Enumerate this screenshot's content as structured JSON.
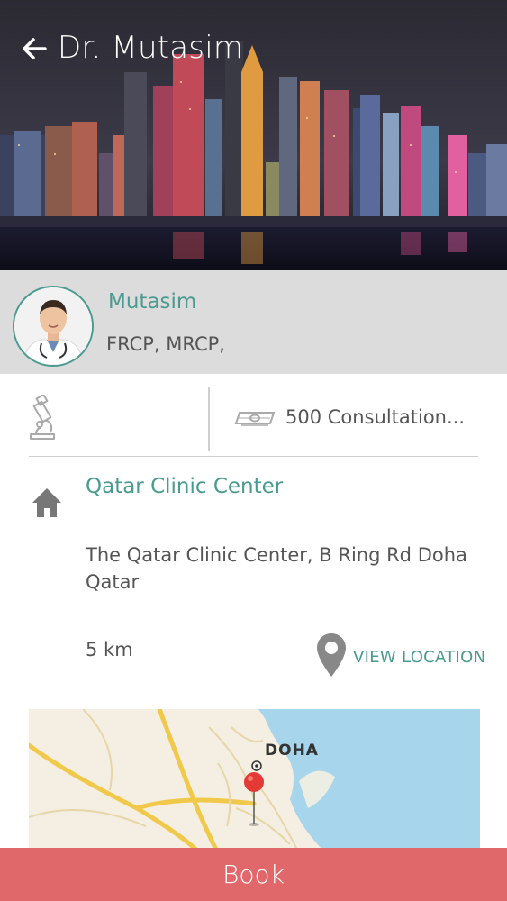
{
  "header": {
    "title": "Dr. Mutasim",
    "back_icon": "arrow-left-icon"
  },
  "profile": {
    "name": "Mutasim",
    "qualifications": "FRCP, MRCP,"
  },
  "info": {
    "specialty_icon": "microscope-icon",
    "fee_icon": "money-icon",
    "fee_text": "500 Consultation..."
  },
  "clinic": {
    "icon": "home-icon",
    "name": "Qatar Clinic Center",
    "address": "The Qatar Clinic Center, B Ring Rd Doha Qatar",
    "distance": "5 km",
    "view_location_label": "VIEW LOCATION"
  },
  "map": {
    "city_label": "DOHA"
  },
  "actions": {
    "book_label": "Book"
  },
  "colors": {
    "accent": "#4a9a8f",
    "book_button": "#e0686a",
    "profile_band": "#dcdcdc",
    "text": "#555555"
  }
}
